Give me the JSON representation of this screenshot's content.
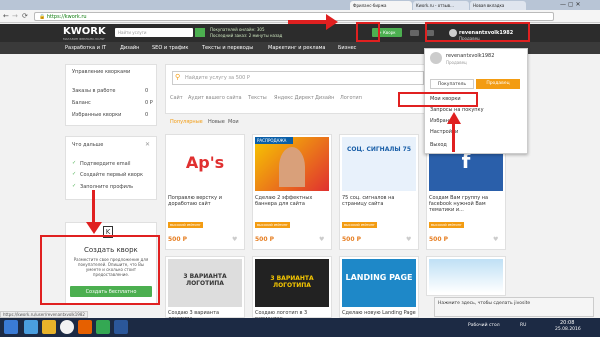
{
  "browser": {
    "tabs": [
      "Фриланс-биржа",
      "Фриланс нового...",
      "Kwork.ru - отзыв...",
      "Новая вкладка"
    ],
    "url": "https://kwork.ru"
  },
  "header": {
    "logo": "KWORK",
    "logo_sub": "МАГАЗИН ФРИЛАНС-УСЛУГ",
    "search_placeholder": "Найти услуги",
    "stat1": "Покупателей онлайн: 305",
    "stat2": "Последний заказ: 2 минуты назад",
    "post_button": "+ Кворк",
    "user_name": "revenantxvolk1982",
    "user_role": "Продавец"
  },
  "menu": [
    "Разработка и IT",
    "Дизайн",
    "SEO и трафик",
    "Тексты и переводы",
    "Маркетинг и реклама",
    "Бизнес",
    "Аудио и видео"
  ],
  "left_panel": {
    "manage_title": "Управление кворками",
    "items": [
      {
        "label": "Заказы в работе",
        "value": "0"
      },
      {
        "label": "Баланс",
        "value": "0 Р"
      },
      {
        "label": "Избранные кворки",
        "value": "0"
      }
    ],
    "next_title": "Что дальше",
    "next_items": [
      "Подтвердите email",
      "Создайте первый кворк",
      "Заполните профиль"
    ],
    "create": {
      "title": "Создать кворк",
      "text": "Разместите свое предложение для покупателей. Опишите, что Вы умеете и сколько стоит предоставление.",
      "button": "Создать бесплатно"
    }
  },
  "main": {
    "search_placeholder": "Найдите услугу за 500 Р",
    "tags": [
      "Сайт",
      "Аудит вашего сайта",
      "Тексты",
      "Яндекс Директ",
      "Дизайн",
      "Логотип"
    ],
    "filters": [
      "Популярные",
      "Новые",
      "Мои"
    ],
    "cards": [
      {
        "title": "Поправлю верстку и доработаю сайт",
        "badge": "ВЫСОКИЙ РЕЙТИНГ",
        "price": "500 Р",
        "thumb_text": "Ap's"
      },
      {
        "title": "Сделаю 2 эффектных баннера для сайта",
        "badge": "ВЫСОКИЙ РЕЙТИНГ",
        "price": "500 Р",
        "thumb_text": "РАСПРОДАЖА"
      },
      {
        "title": "75 соц. сигналов на страницу сайта",
        "badge": "ВЫСОКИЙ РЕЙТИНГ",
        "price": "500 Р",
        "thumb_text": "СОЦ. СИГНАЛЫ 75"
      },
      {
        "title": "Создам Вам группу на facebook нужной Вам тематики и...",
        "badge": "ВЫСОКИЙ РЕЙТИНГ",
        "price": "500 Р",
        "thumb_text": "f"
      }
    ],
    "row2": [
      {
        "title": "Создаю 3 варианта логотипа",
        "thumb_text": "3 ВАРИАНТА ЛОГОТИПА"
      },
      {
        "title": "Создаю логотип в 3 вариантах",
        "thumb_text": "3 ВАРИАНТА ЛОГОТИПА"
      },
      {
        "title": "Сделаю новую Landing Page",
        "thumb_text": "LANDING PAGE"
      },
      {
        "title": "",
        "thumb_text": ""
      }
    ]
  },
  "dropdown": {
    "name": "revenantxvolk1982",
    "role": "Продавец",
    "toggle_buyer": "Покупатель",
    "toggle_seller": "Продавец",
    "items": [
      "Мои кворки",
      "Запросы на покупку",
      "Избранное",
      "Настройки",
      "Выход"
    ]
  },
  "status_url": "https://kwork.ru/user/revenantxvolk1982",
  "notification": "Нажмите здесь, чтобы сделать jivosite",
  "taskbar": {
    "time": "20:08",
    "date": "25.08.2016",
    "lang": "RU",
    "desktop": "Рабочий стол"
  },
  "colors": {
    "accent": "#4caf50",
    "header": "#2c2c2c",
    "highlight": "#e02020",
    "badge": "#f39c12"
  }
}
